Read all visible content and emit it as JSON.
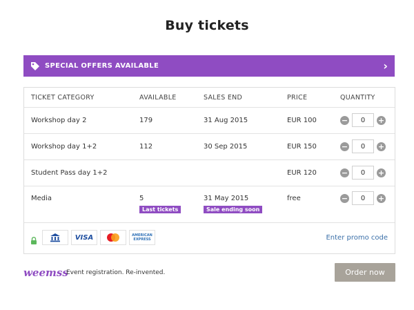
{
  "page": {
    "title": "Buy tickets"
  },
  "offers": {
    "label": "SPECIAL OFFERS AVAILABLE",
    "icon": "tag-icon",
    "color": "#8f4cc2"
  },
  "table": {
    "headers": {
      "category": "TICKET CATEGORY",
      "available": "AVAILABLE",
      "sales_end": "SALES END",
      "price": "PRICE",
      "quantity": "QUANTITY"
    },
    "rows": [
      {
        "category": "Workshop day 2",
        "available": "179",
        "sales_end": "31 Aug 2015",
        "price": "EUR 100",
        "quantity": "0"
      },
      {
        "category": "Workshop day 1+2",
        "available": "112",
        "sales_end": "30 Sep 2015",
        "price": "EUR 150",
        "quantity": "0"
      },
      {
        "category": "Student Pass day 1+2",
        "available": "",
        "sales_end": "",
        "price": "EUR 120",
        "quantity": "0"
      },
      {
        "category": "Media",
        "available": "5",
        "sales_end": "31 May 2015",
        "price": "free",
        "quantity": "0",
        "available_badge": "Last tickets",
        "sales_end_badge": "Sale ending soon"
      }
    ]
  },
  "payment": {
    "methods": [
      "bank-icon",
      "visa-logo",
      "mastercard-logo",
      "amex-logo"
    ],
    "visa_text": "VISA",
    "amex_text": "AMERICAN EXPRESS",
    "promo_label": "Enter promo code"
  },
  "footer": {
    "logo_text": "weemss",
    "tagline": "Event registration. Re-invented.",
    "order_label": "Order now"
  }
}
